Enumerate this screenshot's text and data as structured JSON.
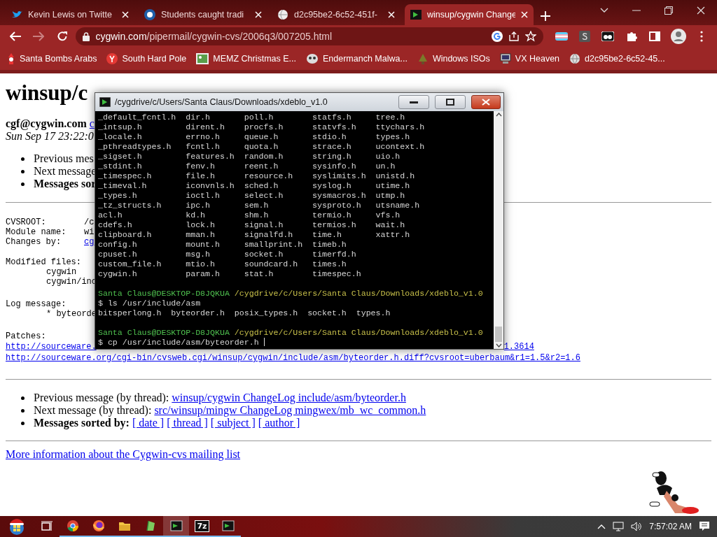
{
  "browser": {
    "tabs": [
      {
        "title": "Kevin Lewis on Twitte",
        "selected": false
      },
      {
        "title": "Students caught tradi",
        "selected": false
      },
      {
        "title": "d2c95be2-6c52-451f-",
        "selected": false
      },
      {
        "title": "winsup/cygwin Change",
        "selected": true
      }
    ],
    "forward_disabled": true,
    "address": {
      "domain": "cygwin.com",
      "path": "/pipermail/cygwin-cvs/2006q3/007205.html"
    },
    "bookmarks": [
      {
        "kind": "santa",
        "label": "Santa Bombs Arabs"
      },
      {
        "kind": "y",
        "label": "South Hard Pole"
      },
      {
        "kind": "image",
        "label": "MEMZ Christmas E..."
      },
      {
        "kind": "mask",
        "label": "Endermanch Malwa..."
      },
      {
        "kind": "tree",
        "label": "Windows ISOs"
      },
      {
        "kind": "computer",
        "label": "VX Heaven"
      },
      {
        "kind": "globe",
        "label": "d2c95be2-6c52-45..."
      }
    ]
  },
  "page": {
    "heading": "winsup/c",
    "author": "cgf@cygwin.com",
    "author_link": "c",
    "date": "Sun Sep 17 23:22:0",
    "nav_top": [
      {
        "text": "Previous mes",
        "bold": false
      },
      {
        "text": "Next message",
        "bold": false
      },
      {
        "text": "Messages sor",
        "bold": true
      }
    ],
    "header_fields": [
      {
        "label": "CVSROOT:",
        "value": "/c",
        "link": false
      },
      {
        "label": "Module name:",
        "value": "wi",
        "link": false
      },
      {
        "label": "Changes by:",
        "value": "cg",
        "link": true
      }
    ],
    "modified_label": "Modified files:",
    "modified_files": [
      "cygwin",
      "cygwin/inc"
    ],
    "log_label": "Log message:",
    "log_text": "* byteorde",
    "patches_label": "Patches:",
    "patch_links": [
      {
        "start": "http://sourceware.",
        "end": "1.3614"
      },
      {
        "start": "http://sourceware.org/cgi-bin/cvsweb.cgi/winsup/cygwin/include/asm/byteorder.h.diff?cvsroot=uberbaum&r1=1.5&r2=1.6"
      }
    ],
    "thread_nav": [
      {
        "label": "Previous message (by thread):",
        "link": "winsup/cygwin ChangeLog include/asm/byteorder.h"
      },
      {
        "label": "Next message (by thread):",
        "link": "src/winsup/mingw ChangeLog mingwex/mb_wc_common.h"
      }
    ],
    "sorted_label": "Messages sorted by:",
    "sort_links": [
      "[ date ]",
      "[ thread ]",
      "[ subject ]",
      "[ author ]"
    ],
    "footer_link": "More information about the Cygwin-cvs mailing list"
  },
  "terminal": {
    "title": "/cygdrive/c/Users/Santa Claus/Downloads/xdeblo_v1.0",
    "listing": [
      [
        "_default_fcntl.h",
        "dir.h",
        "poll.h",
        "statfs.h",
        "tree.h"
      ],
      [
        "_intsup.h",
        "dirent.h",
        "procfs.h",
        "statvfs.h",
        "ttychars.h"
      ],
      [
        "_locale.h",
        "errno.h",
        "queue.h",
        "stdio.h",
        "types.h"
      ],
      [
        "_pthreadtypes.h",
        "fcntl.h",
        "quota.h",
        "strace.h",
        "ucontext.h"
      ],
      [
        "_sigset.h",
        "features.h",
        "random.h",
        "string.h",
        "uio.h"
      ],
      [
        "_stdint.h",
        "fenv.h",
        "reent.h",
        "sysinfo.h",
        "un.h"
      ],
      [
        "_timespec.h",
        "file.h",
        "resource.h",
        "syslimits.h",
        "unistd.h"
      ],
      [
        "_timeval.h",
        "iconvnls.h",
        "sched.h",
        "syslog.h",
        "utime.h"
      ],
      [
        "_types.h",
        "ioctl.h",
        "select.h",
        "sysmacros.h",
        "utmp.h"
      ],
      [
        "_tz_structs.h",
        "ipc.h",
        "sem.h",
        "sysproto.h",
        "utsname.h"
      ],
      [
        "acl.h",
        "kd.h",
        "shm.h",
        "termio.h",
        "vfs.h"
      ],
      [
        "cdefs.h",
        "lock.h",
        "signal.h",
        "termios.h",
        "wait.h"
      ],
      [
        "clipboard.h",
        "mman.h",
        "signalfd.h",
        "time.h",
        "xattr.h"
      ],
      [
        "config.h",
        "mount.h",
        "smallprint.h",
        "timeb.h"
      ],
      [
        "cpuset.h",
        "msg.h",
        "socket.h",
        "timerfd.h"
      ],
      [
        "custom_file.h",
        "mtio.h",
        "soundcard.h",
        "times.h"
      ],
      [
        "cygwin.h",
        "param.h",
        "stat.h",
        "timespec.h"
      ]
    ],
    "session": [
      {
        "kind": "prompt",
        "user": "Santa Claus@DESKTOP-D8JQKUA",
        "path": "/cygdrive/c/Users/Santa Claus/Downloads/xdeblo_v1.0"
      },
      {
        "kind": "command",
        "text": "$ ls /usr/include/asm",
        "cursor": false
      },
      {
        "kind": "output",
        "items": [
          "bitsperlong.h",
          "byteorder.h",
          "posix_types.h",
          "socket.h",
          "types.h"
        ]
      },
      {
        "kind": "prompt",
        "user": "Santa Claus@DESKTOP-D8JQKUA",
        "path": "/cygdrive/c/Users/Santa Claus/Downloads/xdeblo_v1.0"
      },
      {
        "kind": "command",
        "text": "$ cp /usr/include/asm/byteorder.h",
        "cursor": true
      }
    ]
  },
  "taskbar": {
    "apps": [
      {
        "kind": "task-view",
        "running": false,
        "selected": false
      },
      {
        "kind": "chrome",
        "running": true,
        "selected": false
      },
      {
        "kind": "firefox",
        "running": true,
        "selected": false
      },
      {
        "kind": "folder",
        "running": true,
        "selected": false
      },
      {
        "kind": "leaf",
        "running": true,
        "selected": false
      },
      {
        "kind": "terminal",
        "running": true,
        "selected": true
      },
      {
        "kind": "archive",
        "label": "7z",
        "running": true,
        "selected": false
      },
      {
        "kind": "terminal",
        "running": true,
        "selected": false
      }
    ],
    "clock": "7:57:02 AM"
  }
}
